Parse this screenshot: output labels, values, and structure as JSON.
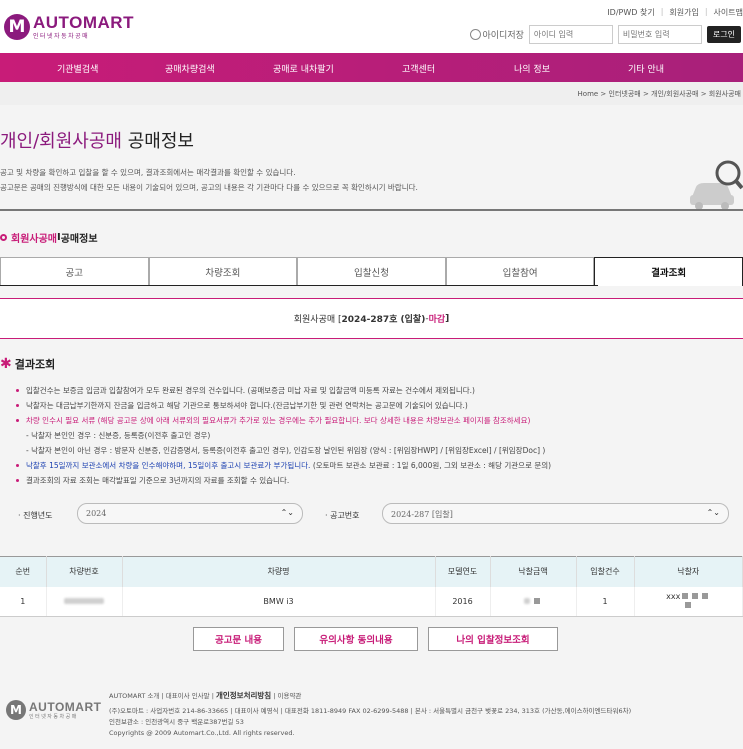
{
  "brand": {
    "name": "AUTOMART",
    "sub": "인터넷자동차공매",
    "mark": "M"
  },
  "top_links": [
    "ID/PWD 찾기",
    "회원가입",
    "사이트맵"
  ],
  "login": {
    "id_save": "아이디저장",
    "id_placeholder": "아이디 입력",
    "pw_placeholder": "비밀번호 입력",
    "button": "로그인"
  },
  "nav": [
    "기관별검색",
    "공매차량검색",
    "공매로 내차팔기",
    "고객센터",
    "나의 정보",
    "기타 안내"
  ],
  "breadcrumb": "Home > 인터넷공매 > 개인/회원사공매 > 회원사공매",
  "page_title": {
    "highlight": "개인/회원사공매",
    "rest": "공매정보"
  },
  "description": [
    "공고 및 차량을 확인하고 입찰을 할 수 있으며, 결과조회에서는 매각결과를 확인할 수 있습니다.",
    "공고문은 공매의 진행방식에 대한 모든 내용이 기술되어 있으며, 공고의 내용은 각 기관마다 다를 수 있으므로 꼭 확인하시기 바랍니다."
  ],
  "section": {
    "pink": "회원사공매",
    "sep": " I ",
    "rest": "공매정보"
  },
  "tabs": [
    "공고",
    "차량조회",
    "입찰신청",
    "입찰참여",
    "결과조회"
  ],
  "auction_line": {
    "prefix": "회원사공매 [ ",
    "no": "2024-287호 (입찰)",
    "dash": " - ",
    "status": "마감",
    "suffix": " ]"
  },
  "result_title": "결과조회",
  "notes": {
    "n1": "입찰건수는 보증금 입금과 입찰참여가 모두 완료된 경우의 건수입니다. (공매보증금 미납 자료 및 입찰금액 미등록 자료는 건수에서 제외됩니다.)",
    "n2": "낙찰자는 대금납부기한까지 잔금을 입금하고 해당 기관으로 통보하셔야 합니다.(잔금납부기한 및 관련 연락처는 공고문에 기술되어 있습니다.)",
    "n3": "차량 인수시 필요 서류 (해당 공고문 상에 아래 서류외의 필요서류가 추가로 있는 경우에는 추가 필요합니다. 보다 상세한 내용은 차량보관소 페이지를 참조하세요)",
    "n3a": "- 낙찰자 본인인 경우 : 신분증, 등록증(이전후 출고인 경우)",
    "n3b": "- 낙찰자 본인이 아닌 경우 : 방문자 신분증, 인감증명서, 등록증(이전후 출고인 경우), 인감도장 날인된 위임장 (양식 : [위임장HWP] / [위임장Excel] / [위임장Doc] )",
    "n4_blue": "낙찰후 15일까지 보관소에서 차량을 인수해야하며, 15일이후 출고시 보관료가 부가됩니다.",
    "n4_rest": " (오토마트 보관소 보관료 : 1일 6,000원, 그외 보관소 : 해당 기관으로 문의)",
    "n5": "결과조회의 자료 조회는 매각발표일 기준으로 3년까지의 자료를 조회할 수 있습니다."
  },
  "filter": {
    "year_label": "· 진행년도",
    "year_value": "2024",
    "notice_label": "· 공고번호",
    "notice_value": "2024-287 [입찰]"
  },
  "table": {
    "headers": [
      "순번",
      "차량번호",
      "차량명",
      "모델연도",
      "낙찰금액",
      "입찰건수",
      "낙찰자"
    ],
    "rows": [
      {
        "no": "1",
        "car_name": "BMW i3",
        "year": "2016",
        "bids": "1",
        "winner_prefix": "xxx"
      }
    ]
  },
  "buttons": [
    "공고문 내용",
    "유의사항 동의내용",
    "나의 입찰정보조회"
  ],
  "footer": {
    "links": "AUTOMART 소개 | 대표이사 인사말 | ",
    "privacy": "개인정보처리방침",
    "links2": " | 이용약관",
    "line1": "(주)오토마트 : 사업자번호 214-86-33665 | 대표이사 예영식 | 대표전화 1811-8949  FAX 02-6299-5488 | 본사 : 서울특별시 금천구 벚꽃로 234, 313호 (가산동,에이스하이엔드타워6차)",
    "line2": "인천보관소 : 인천광역시 중구 백운로387번길 53",
    "copyright": "Copyrights @ 2009 Automart.Co.,Ltd. All rights reserved."
  },
  "colors": {
    "brand": "#8b1a7d",
    "accent": "#c81c78",
    "nav": "#b81e79",
    "table_header": "#e6f3f6"
  }
}
